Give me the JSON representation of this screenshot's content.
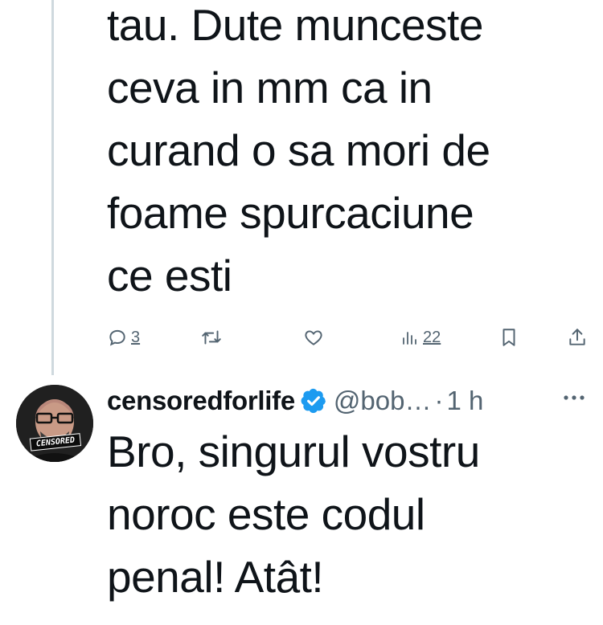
{
  "tweet1": {
    "text": "tau. Dute munceste\nceva in mm ca in\ncurand o sa mori de\nfoame spurcaciune\nce esti",
    "actions": {
      "reply_count": "3",
      "retweet_count": "",
      "like_count": "",
      "views_count": "22"
    }
  },
  "tweet2": {
    "display_name": "censoredforlife",
    "handle": "@bob…",
    "separator": "·",
    "time": "1 h",
    "avatar_label": "CENSORED",
    "text": "Bro, singurul vostru\nnoroc este codul\npenal! Atât!"
  },
  "colors": {
    "text": "#0f1419",
    "secondary": "#536471",
    "verified": "#1d9bf0",
    "thread_line": "#cfd9de"
  },
  "icons": [
    "reply-icon",
    "retweet-icon",
    "like-icon",
    "views-icon",
    "bookmark-icon",
    "share-icon",
    "verified-badge-icon",
    "more-icon"
  ]
}
